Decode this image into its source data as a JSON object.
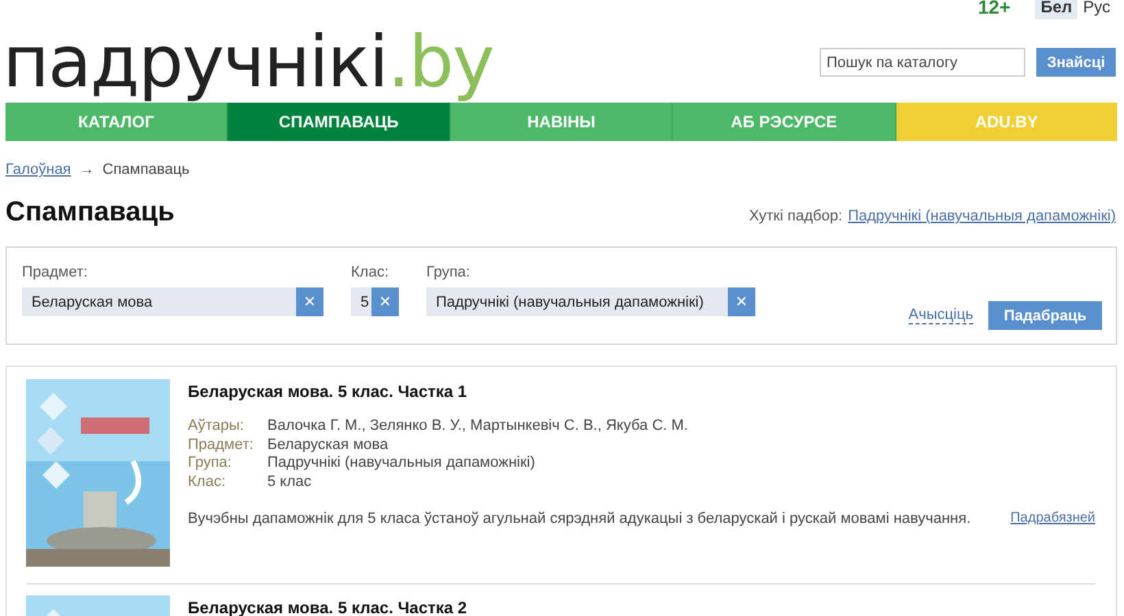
{
  "header": {
    "age_rating": "12+",
    "languages": [
      {
        "label": "Бел",
        "selected": true
      },
      {
        "label": "Рус",
        "selected": false
      }
    ],
    "logo": {
      "name": "падручнікі",
      "domain": ".by"
    },
    "search": {
      "placeholder": "Пошук па каталогу",
      "button": "Знайсці"
    }
  },
  "nav": [
    {
      "label": "КАТАЛОГ",
      "kind": "normal",
      "selected": false
    },
    {
      "label": "СПАМПАВАЦЬ",
      "kind": "normal",
      "selected": true
    },
    {
      "label": "НАВІНЫ",
      "kind": "normal",
      "selected": false
    },
    {
      "label": "АБ РЭСУРСЕ",
      "kind": "normal",
      "selected": false
    },
    {
      "label": "ADU.BY",
      "kind": "external",
      "selected": false
    }
  ],
  "breadcrumbs": [
    {
      "label": "Галоўная",
      "kind": "link"
    },
    {
      "label": "→",
      "kind": "separator"
    },
    {
      "label": "Спампаваць",
      "kind": "current"
    }
  ],
  "page_title": "Спампаваць",
  "quick_pick": {
    "label": "Хуткі падбор:",
    "link": "Падручнікі (навучальныя дапаможнікі)"
  },
  "filters": {
    "fields": [
      {
        "label": "Прадмет:",
        "value": "Беларуская мова",
        "clear": "✕"
      },
      {
        "label": "Клас:",
        "value": "5",
        "clear": "✕"
      },
      {
        "label": "Група:",
        "value": "Падручнікі (навучальныя дапаможнікі)",
        "clear": "✕"
      }
    ],
    "reset": "Ачысціць",
    "submit": "Падабраць"
  },
  "results": [
    {
      "title": "Беларуская мова. 5 клас. Частка 1",
      "cover": {
        "kind": "picture"
      },
      "details": [
        {
          "key": "Аўтары:",
          "value": "Валочка Г. М., Зелянко В. У., Мартынкевіч С. В., Якуба С. М."
        },
        {
          "key": "Прадмет:",
          "value": "Беларуская мова"
        },
        {
          "key": "Група:",
          "value": "Падручнікі (навучальныя дапаможнікі)"
        },
        {
          "key": "Клас:",
          "value": "5 клас"
        }
      ],
      "description": "Вучэбны дапаможнік для 5 класа ўстаноў агульнай сярэдняй адукацыі з беларускай і рускай мовамі навучання.",
      "more": "Падрабязней"
    },
    {
      "title": "Беларуская мова. 5 клас. Частка 2",
      "cover": {
        "kind": "picture"
      }
    }
  ]
}
